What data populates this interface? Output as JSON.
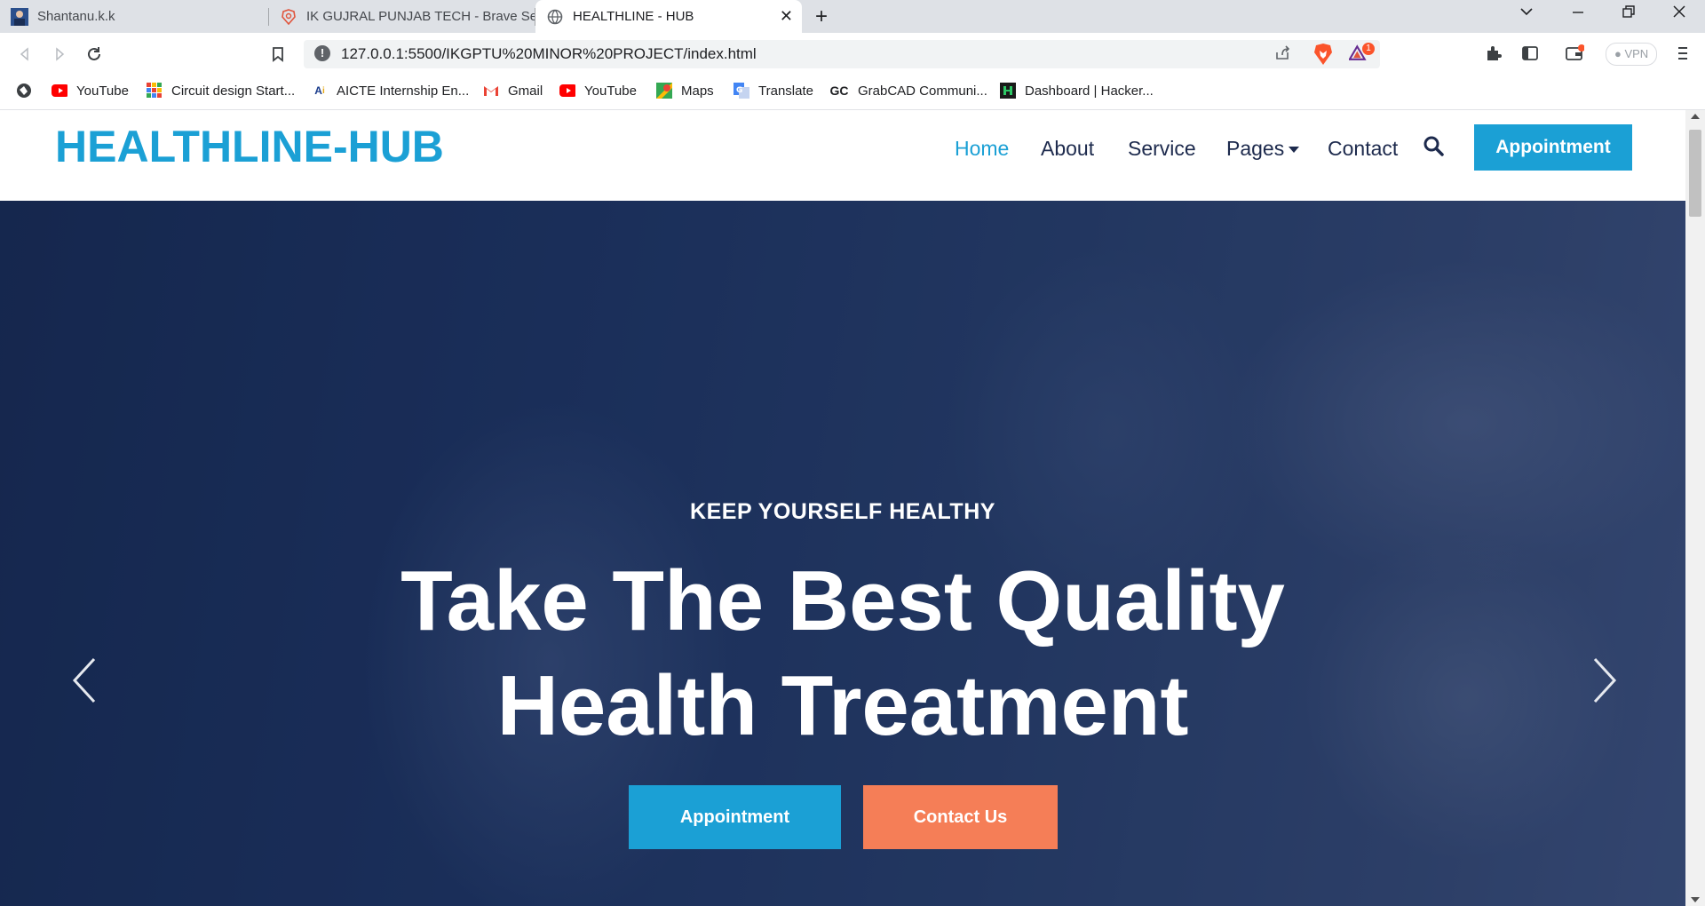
{
  "browser": {
    "tabs": [
      {
        "title": "Shantanu.k.k",
        "icon": "profile-photo-icon",
        "active": false
      },
      {
        "title": "IK GUJRAL PUNJAB TECH - Brave Search",
        "icon": "brave-search-icon",
        "active": false
      },
      {
        "title": "HEALTHLINE - HUB",
        "icon": "globe-icon",
        "active": true
      }
    ],
    "url": "127.0.0.1:5500/IKGPTU%20MINOR%20PROJECT/index.html",
    "vpn_label": "VPN",
    "rewards_badge": "1",
    "bookmarks": [
      {
        "label": "YouTube",
        "icon": "youtube-icon"
      },
      {
        "label": "Circuit design Start...",
        "icon": "circuit-grid-icon"
      },
      {
        "label": "AICTE Internship En...",
        "icon": "aicte-icon"
      },
      {
        "label": "Gmail",
        "icon": "gmail-icon"
      },
      {
        "label": "YouTube",
        "icon": "youtube-icon"
      },
      {
        "label": "Maps",
        "icon": "maps-icon"
      },
      {
        "label": "Translate",
        "icon": "translate-icon"
      },
      {
        "label": "GrabCAD Communi...",
        "icon": "grabcad-icon"
      },
      {
        "label": "Dashboard | Hacker...",
        "icon": "hackerrank-icon"
      }
    ]
  },
  "site": {
    "brand": "HEALTHLINE-HUB",
    "nav": [
      {
        "label": "Home",
        "active": true
      },
      {
        "label": "About",
        "active": false
      },
      {
        "label": "Service",
        "active": false
      },
      {
        "label": "Pages",
        "active": false,
        "dropdown": true
      },
      {
        "label": "Contact",
        "active": false
      }
    ],
    "nav_button": "Appointment",
    "hero": {
      "kicker": "KEEP YOURSELF HEALTHY",
      "title_line1": "Take The Best Quality",
      "title_line2": "Health Treatment",
      "primary_button": "Appointment",
      "secondary_button": "Contact Us"
    }
  },
  "colors": {
    "primary": "#1ba0d5",
    "secondary": "#f57e57",
    "navy": "#1d2a4d",
    "hero_overlay": "#132550"
  }
}
